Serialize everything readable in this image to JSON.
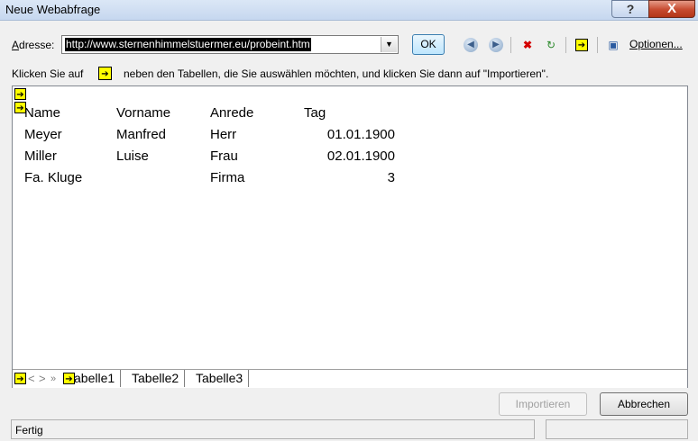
{
  "window": {
    "title": "Neue Webabfrage",
    "help_label": "?",
    "close_label": "X"
  },
  "address": {
    "label": "Adresse:",
    "value": "http://www.sternenhimmelstuermer.eu/probeint.htm",
    "ok_label": "OK"
  },
  "toolbar": {
    "icons": [
      "back-icon",
      "forward-icon",
      "stop-icon",
      "refresh-icon",
      "hide-icons-icon",
      "save-query-icon"
    ],
    "options_label": "Optionen..."
  },
  "instructions": {
    "prefix": "Klicken Sie auf",
    "suffix": "neben den Tabellen, die Sie auswählen möchten, und klicken Sie dann auf \"Importieren\"."
  },
  "table": {
    "headers": [
      "Name",
      "Vorname",
      "Anrede",
      "Tag"
    ],
    "rows": [
      [
        "Meyer",
        "Manfred",
        "Herr",
        "01.01.1900"
      ],
      [
        "Miller",
        "Luise",
        "Frau",
        "02.01.1900"
      ],
      [
        "Fa. Kluge",
        "",
        "Firma",
        "3"
      ]
    ]
  },
  "sheet_tabs": {
    "nav": [
      "<",
      ">",
      "»"
    ],
    "tabs": [
      "abelle1",
      "Tabelle2",
      "Tabelle3"
    ]
  },
  "buttons": {
    "import_label": "Importieren",
    "cancel_label": "Abbrechen"
  },
  "status": {
    "text": "Fertig"
  }
}
